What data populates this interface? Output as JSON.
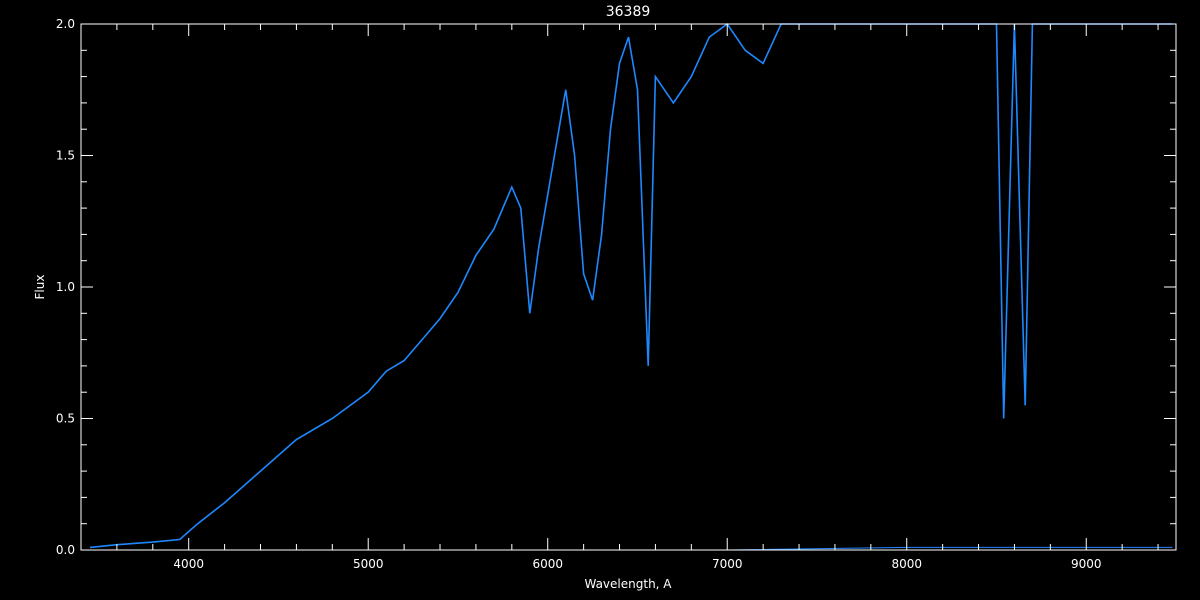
{
  "chart_data": {
    "type": "line",
    "title": "36389",
    "xlabel": "Wavelength, A",
    "ylabel": "Flux",
    "xlim": [
      3400,
      9500
    ],
    "ylim": [
      0,
      2.0
    ],
    "x_ticks": [
      4000,
      5000,
      6000,
      7000,
      8000,
      9000
    ],
    "x_tick_labels": [
      "4000",
      "5000",
      "6000",
      "7000",
      "8000",
      "9000"
    ],
    "y_ticks": [
      0,
      0.5,
      1.0,
      1.5,
      2.0
    ],
    "y_tick_labels": [
      "0.0",
      "0.5",
      "1.0",
      "1.5",
      "2.0"
    ],
    "grid": false,
    "background_color": "#000000",
    "axis_color": "#ffffff",
    "series": [
      {
        "color": "#1e88ff",
        "x": [
          3450,
          3600,
          3800,
          3950,
          4050,
          4200,
          4400,
          4600,
          4800,
          5000,
          5100,
          5200,
          5300,
          5400,
          5500,
          5600,
          5700,
          5800,
          5850,
          5900,
          5950,
          6000,
          6050,
          6100,
          6150,
          6200,
          6250,
          6300,
          6350,
          6400,
          6450,
          6500,
          6560,
          6600,
          6700,
          6800,
          6900,
          7000,
          7100,
          7200,
          7300,
          7500,
          7700,
          8000,
          8300,
          8500,
          8540,
          8600,
          8660,
          8700,
          9000,
          9480
        ],
        "y": [
          0.01,
          0.02,
          0.03,
          0.04,
          0.1,
          0.18,
          0.3,
          0.42,
          0.5,
          0.6,
          0.68,
          0.72,
          0.8,
          0.88,
          0.98,
          1.12,
          1.22,
          1.38,
          1.3,
          0.9,
          1.15,
          1.35,
          1.55,
          1.75,
          1.5,
          1.05,
          0.95,
          1.2,
          1.6,
          1.85,
          1.95,
          1.75,
          0.7,
          1.8,
          1.7,
          1.8,
          1.95,
          2.0,
          1.9,
          1.85,
          2.0,
          2.0,
          2.0,
          2.0,
          2.0,
          2.0,
          0.5,
          2.0,
          0.55,
          2.0,
          2.0,
          2.0
        ]
      },
      {
        "color": "#1e88ff",
        "x": [
          4000,
          5000,
          6000,
          7000,
          8000,
          9000,
          9480
        ],
        "y": [
          0.0,
          0.0,
          0.0,
          0.0,
          0.01,
          0.01,
          0.01
        ]
      }
    ]
  }
}
